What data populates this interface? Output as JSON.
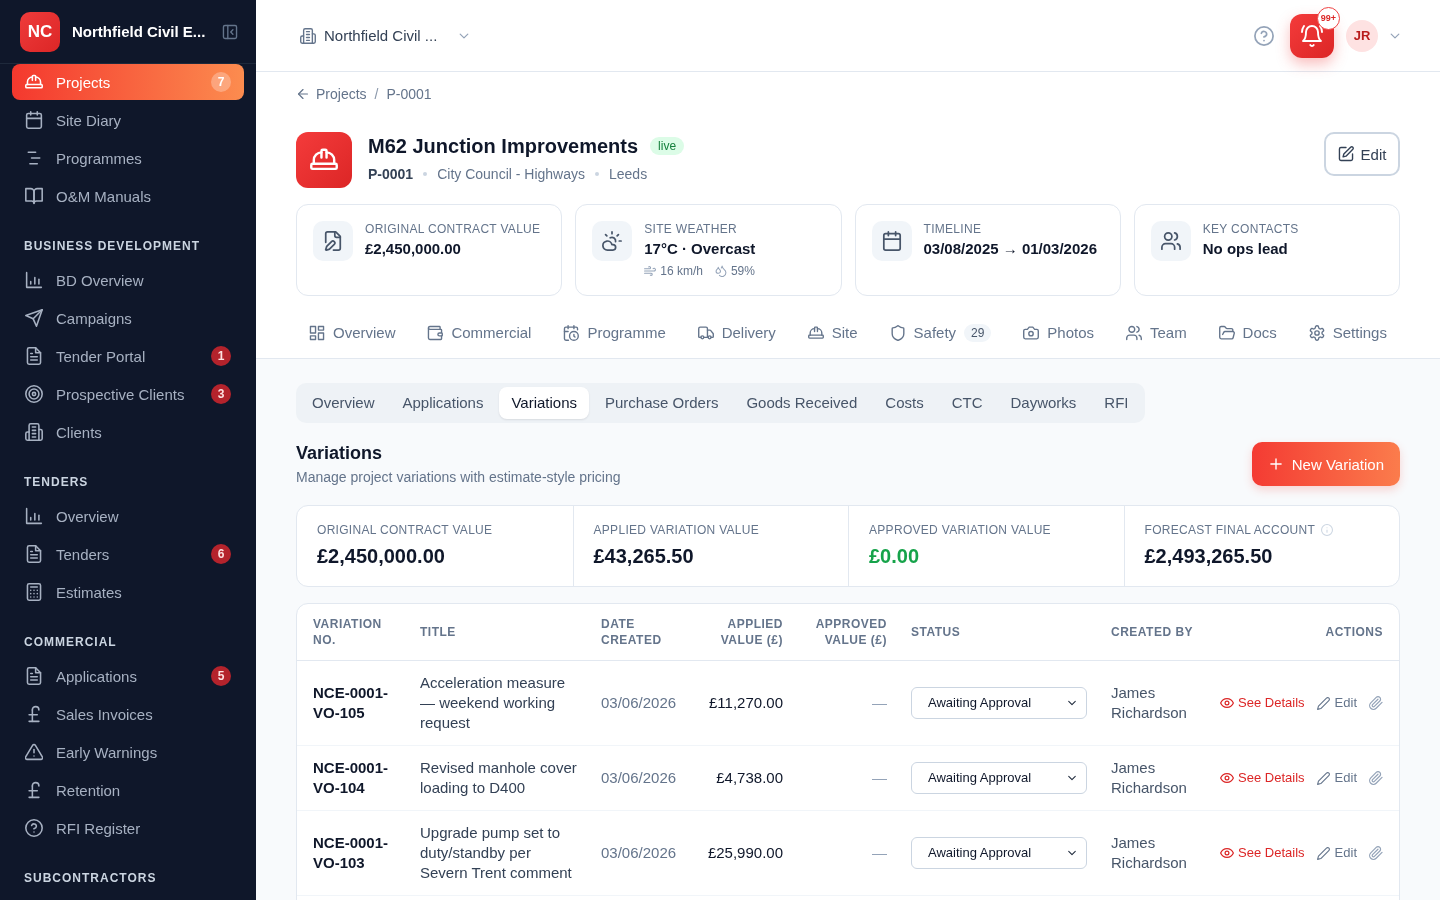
{
  "sidebar": {
    "logo": "NC",
    "title": "Northfield Civil E...",
    "items": [
      {
        "label": "Projects",
        "badge": "7",
        "selected": true
      },
      {
        "label": "Site Diary",
        "selected": false
      },
      {
        "label": "Programmes",
        "selected": false
      },
      {
        "label": "O&M Manuals",
        "selected": false
      }
    ],
    "sections": [
      {
        "title": "BUSINESS DEVELOPMENT",
        "items": [
          {
            "label": "BD Overview",
            "selected": false
          },
          {
            "label": "Campaigns",
            "selected": false
          },
          {
            "label": "Tender Portal",
            "badge": "1",
            "selected": false
          },
          {
            "label": "Prospective Clients",
            "badge": "3",
            "selected": false
          },
          {
            "label": "Clients",
            "selected": false
          }
        ]
      },
      {
        "title": "TENDERS",
        "items": [
          {
            "label": "Overview",
            "selected": false
          },
          {
            "label": "Tenders",
            "badge": "6",
            "selected": false
          },
          {
            "label": "Estimates",
            "selected": false
          }
        ]
      },
      {
        "title": "COMMERCIAL",
        "items": [
          {
            "label": "Applications",
            "badge": "5",
            "selected": false
          },
          {
            "label": "Sales Invoices",
            "selected": false
          },
          {
            "label": "Early Warnings",
            "selected": false
          },
          {
            "label": "Retention",
            "selected": false
          },
          {
            "label": "RFI Register",
            "selected": false
          }
        ]
      },
      {
        "title": "SUBCONTRACTORS"
      }
    ]
  },
  "topbar": {
    "organisation": "Northfield Civil ...",
    "notification_count": "99+",
    "avatar": "JR"
  },
  "breadcrumb": {
    "items": [
      "Projects",
      "P-0001"
    ],
    "separator": "/"
  },
  "project": {
    "title": "M62 Junction Improvements",
    "status": "live",
    "meta": [
      "P-0001",
      "City Council - Highways",
      "Leeds"
    ],
    "edit_button": "Edit"
  },
  "stats": [
    {
      "label": "ORIGINAL CONTRACT VALUE",
      "value": "£2,450,000.00"
    },
    {
      "label": "SITE WEATHER",
      "value": "17°C · Overcast",
      "details": [
        "16 km/h",
        "59%"
      ]
    },
    {
      "label": "TIMELINE",
      "value": "03/08/2025 → 01/03/2026"
    },
    {
      "label": "KEY CONTACTS",
      "value": "No ops lead"
    }
  ],
  "tabs": [
    {
      "label": "Overview",
      "selected": false
    },
    {
      "label": "Commercial",
      "selected": false
    },
    {
      "label": "Programme",
      "selected": false
    },
    {
      "label": "Delivery",
      "selected": false
    },
    {
      "label": "Site",
      "selected": false
    },
    {
      "label": "Safety",
      "count": "29",
      "selected": false
    },
    {
      "label": "Photos",
      "selected": false
    },
    {
      "label": "Team",
      "selected": false
    },
    {
      "label": "Docs",
      "selected": false
    },
    {
      "label": "Settings",
      "selected": false
    }
  ],
  "subtabs": [
    {
      "label": "Overview",
      "selected": false
    },
    {
      "label": "Applications",
      "selected": false
    },
    {
      "label": "Variations",
      "selected": true
    },
    {
      "label": "Purchase Orders",
      "selected": false
    },
    {
      "label": "Goods Received",
      "selected": false
    },
    {
      "label": "Costs",
      "selected": false
    },
    {
      "label": "CTC",
      "selected": false
    },
    {
      "label": "Dayworks",
      "selected": false
    },
    {
      "label": "RFI",
      "selected": false
    }
  ],
  "variations": {
    "title": "Variations",
    "subtitle": "Manage project variations with estimate-style pricing",
    "new_button": "New Variation",
    "summary": [
      {
        "label": "ORIGINAL CONTRACT VALUE",
        "value": "£2,450,000.00",
        "color": "#0f172a",
        "info": false
      },
      {
        "label": "APPLIED VARIATION VALUE",
        "value": "£43,265.50",
        "color": "#0f172a",
        "info": false
      },
      {
        "label": "APPROVED VARIATION VALUE",
        "value": "£0.00",
        "color": "#16a34a",
        "info": false
      },
      {
        "label": "FORECAST FINAL ACCOUNT",
        "value": "£2,493,265.50",
        "color": "#0f172a",
        "info": true
      }
    ],
    "table": {
      "columns": [
        "VARIATION NO.",
        "TITLE",
        "DATE CREATED",
        "APPLIED VALUE (£)",
        "APPROVED VALUE (£)",
        "STATUS",
        "CREATED BY",
        "ACTIONS"
      ],
      "rows": [
        {
          "number": "NCE-0001-VO-105",
          "title": "Acceleration measure — weekend working request",
          "date": "03/06/2026",
          "applied": "£11,270.00",
          "approved": "—",
          "status": "Awaiting Approval",
          "created_by": "James Richardson",
          "actions": [
            "See Details",
            "Edit"
          ]
        },
        {
          "number": "NCE-0001-VO-104",
          "title": "Revised manhole cover loading to D400",
          "date": "03/06/2026",
          "applied": "£4,738.00",
          "approved": "—",
          "status": "Awaiting Approval",
          "created_by": "James Richardson",
          "actions": [
            "See Details",
            "Edit"
          ]
        },
        {
          "number": "NCE-0001-VO-103",
          "title": "Upgrade pump set to duty/standby per Severn Trent comment",
          "date": "03/06/2026",
          "applied": "£25,990.00",
          "approved": "—",
          "status": "Awaiting Approval",
          "created_by": "James Richardson",
          "actions": [
            "See Details",
            "Edit"
          ]
        }
      ]
    }
  }
}
